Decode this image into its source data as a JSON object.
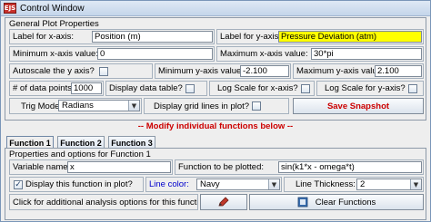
{
  "window": {
    "title": "Control Window",
    "icon_text": "EJS"
  },
  "general": {
    "title": "General Plot Properties",
    "xlabel_label": "Label for x-axis:",
    "xlabel_value": "Position (m)",
    "ylabel_label": "Label for y-axis:",
    "ylabel_value": "Pressure Deviation (atm)",
    "minx_label": "Minimum x-axis value:",
    "minx_value": "0",
    "maxx_label": "Maximum x-axis value:",
    "maxx_value": "30*pi",
    "autoscale_label": "Autoscale the y axis?",
    "autoscale_checked": false,
    "miny_label": "Minimum y-axis value:",
    "miny_value": "-2.100",
    "maxy_label": "Maximum y-axis value:",
    "maxy_value": "2.100",
    "points_label": "# of data points:",
    "points_value": "1000",
    "table_label": "Display data table?",
    "table_checked": false,
    "logx_label": "Log Scale for x-axis?",
    "logx_checked": false,
    "logy_label": "Log Scale for y-axis?",
    "logy_checked": false,
    "trig_label": "Trig Mode:",
    "trig_value": "Radians",
    "grid_label": "Display grid lines in plot?",
    "grid_checked": false,
    "snapshot_label": "Save Snapshot"
  },
  "banner": "-- Modify individual functions below --",
  "tabs": [
    {
      "label": "Function 1"
    },
    {
      "label": "Function 2"
    },
    {
      "label": "Function 3"
    }
  ],
  "function_panel": {
    "title": "Properties and options for Function 1",
    "varname_label": "Variable name:",
    "varname_value": "x",
    "func_label": "Function to be plotted:",
    "func_value": "sin(k1*x - omega*t)",
    "display_label": "Display this function in plot?",
    "display_checked": true,
    "color_label": "Line color:",
    "color_value": "Navy",
    "thickness_label": "Line Thickness:",
    "thickness_value": "2",
    "analysis_label": "Click for additional analysis options for this function:",
    "clear_label": "Clear Functions"
  },
  "colors": {
    "snapshot_text": "#cc0000",
    "banner_text": "#cc0000",
    "line_color_label": "#0000cc",
    "ylabel_field_bg": "#ffff00"
  },
  "icons": {
    "analysis": "pencil-icon",
    "clear": "clear-icon",
    "combo_arrow": "chevron-down-icon"
  }
}
